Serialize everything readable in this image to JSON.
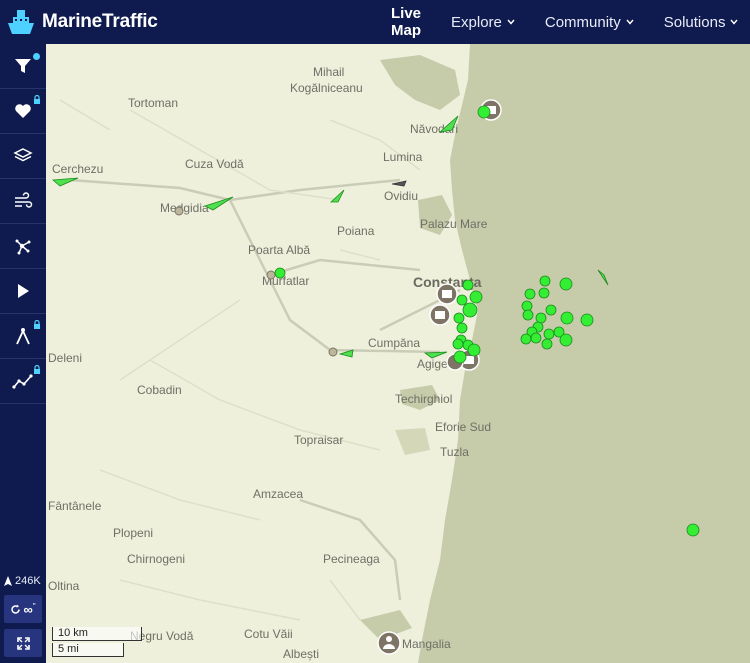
{
  "brand": {
    "name": "MarineTraffic"
  },
  "nav": [
    {
      "label": "Live Map",
      "active": true,
      "dropdown": false
    },
    {
      "label": "Explore",
      "active": false,
      "dropdown": true
    },
    {
      "label": "Community",
      "active": false,
      "dropdown": true
    },
    {
      "label": "Solutions",
      "active": false,
      "dropdown": true
    }
  ],
  "sidebar": {
    "items": [
      {
        "icon": "filter-icon",
        "badge": "dot"
      },
      {
        "icon": "heart-icon",
        "badge": "lock"
      },
      {
        "icon": "layers-icon",
        "badge": "none"
      },
      {
        "icon": "wind-icon",
        "badge": "none"
      },
      {
        "icon": "route-network-icon",
        "badge": "none"
      },
      {
        "icon": "play-icon",
        "badge": "none"
      },
      {
        "icon": "compass-measure-icon",
        "badge": "lock"
      },
      {
        "icon": "chart-line-icon",
        "badge": "lock"
      }
    ],
    "vessel_count": "246K",
    "sync_label": "∞",
    "sync_suffix": "\""
  },
  "map": {
    "places": [
      "Mihail Kogălniceanu",
      "Tortoman",
      "Năvodari",
      "Cuza Vodă",
      "Lumina",
      "Ovidiu",
      "Medgidia",
      "Palazu Mare",
      "Poiana",
      "Poarta Albă",
      "Murfatlar",
      "Constanța",
      "Cumpăna",
      "Agigea",
      "Techirghiol",
      "Cobadin",
      "Eforie Sud",
      "Topraisar",
      "Tuzla",
      "Amzacea",
      "Plopeni",
      "Chirnogeni",
      "Pecineaga",
      "Negru Vodă",
      "Cotu Văii",
      "Albești",
      "Mangalia",
      "Fântânele",
      "Oltina",
      "Deleni",
      "Cerchezu"
    ],
    "scale": {
      "km": "10 km",
      "mi": "5 mi"
    }
  },
  "colors": {
    "nav_bg": "#0f1a4e",
    "land": "#eef0dc",
    "sea": "#c6cbaa",
    "vessel": "#33ee33",
    "badge": "#4fd1ff"
  }
}
